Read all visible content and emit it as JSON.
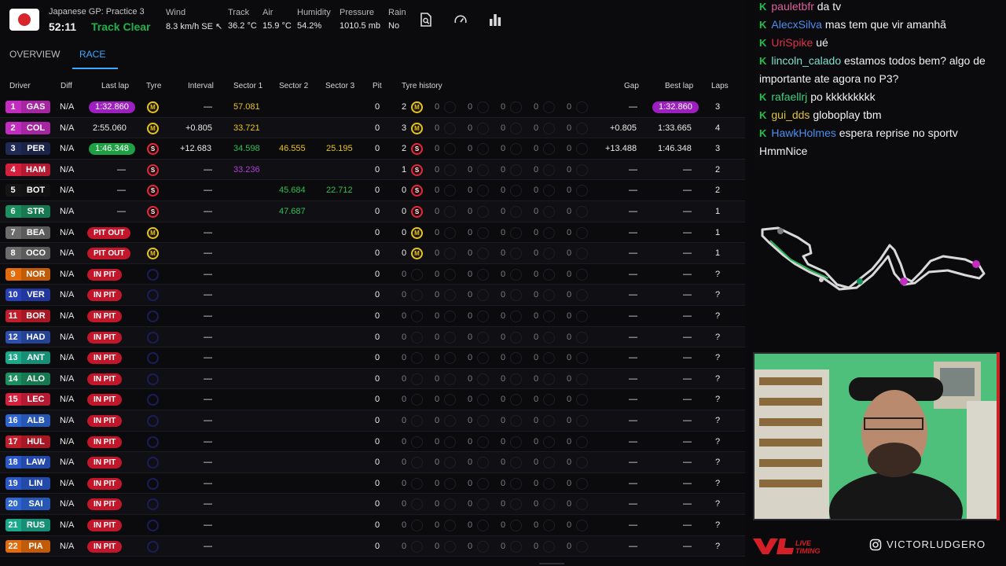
{
  "header": {
    "session_name": "Japanese GP: Practice 3",
    "session_time": "52:11",
    "track_status": "Track Clear",
    "stats": [
      {
        "label": "Wind",
        "value": "8.3 km/h SE ↖"
      },
      {
        "label": "Track",
        "value": "36.2 °C"
      },
      {
        "label": "Air",
        "value": "15.9 °C"
      },
      {
        "label": "Humidity",
        "value": "54.2%"
      },
      {
        "label": "Pressure",
        "value": "1010.5 mb"
      },
      {
        "label": "Rain",
        "value": "No"
      }
    ],
    "icons": [
      "document-search-icon",
      "gauge-icon",
      "bar-chart-icon"
    ]
  },
  "tabs": [
    {
      "label": "OVERVIEW",
      "active": false
    },
    {
      "label": "RACE",
      "active": true
    }
  ],
  "columns": {
    "driver": "Driver",
    "diff": "Diff",
    "last_lap": "Last lap",
    "tyre": "Tyre",
    "interval": "Interval",
    "sector1": "Sector 1",
    "sector2": "Sector 2",
    "sector3": "Sector 3",
    "pit": "Pit",
    "tyre_history": "Tyre history",
    "gap": "Gap",
    "best_lap": "Best lap",
    "laps": "Laps"
  },
  "rows": [
    {
      "pos": "1",
      "code": "GAS",
      "team_color": "#c22cc0",
      "diff": "N/A",
      "last": "1:32.860",
      "last_style": "purple",
      "tyre": "M",
      "interval": "—",
      "s1": "57.081",
      "s1c": "yellow",
      "s2": "",
      "s2c": "",
      "s3": "",
      "s3c": "",
      "pit": "0",
      "hist": [
        {
          "n": "2",
          "t": "M"
        },
        {
          "n": "0"
        },
        {
          "n": "0"
        },
        {
          "n": "0"
        },
        {
          "n": "0"
        },
        {
          "n": "0"
        }
      ],
      "gap": "—",
      "best": "1:32.860",
      "best_style": "purple",
      "laps": "3"
    },
    {
      "pos": "2",
      "code": "COL",
      "team_color": "#c22cc0",
      "diff": "N/A",
      "last": "2:55.060",
      "last_style": "plain",
      "tyre": "M",
      "interval": "+0.805",
      "s1": "33.721",
      "s1c": "yellow",
      "s2": "",
      "s2c": "",
      "s3": "",
      "s3c": "",
      "pit": "0",
      "hist": [
        {
          "n": "3",
          "t": "M"
        },
        {
          "n": "0"
        },
        {
          "n": "0"
        },
        {
          "n": "0"
        },
        {
          "n": "0"
        },
        {
          "n": "0"
        }
      ],
      "gap": "+0.805",
      "best": "1:33.665",
      "best_style": "plain",
      "laps": "4"
    },
    {
      "pos": "3",
      "code": "PER",
      "team_color": "#1f2a55",
      "diff": "N/A",
      "last": "1:46.348",
      "last_style": "green",
      "tyre": "S",
      "interval": "+12.683",
      "s1": "34.598",
      "s1c": "green",
      "s2": "46.555",
      "s2c": "yellow",
      "s3": "25.195",
      "s3c": "yellow",
      "pit": "0",
      "hist": [
        {
          "n": "2",
          "t": "S"
        },
        {
          "n": "0"
        },
        {
          "n": "0"
        },
        {
          "n": "0"
        },
        {
          "n": "0"
        },
        {
          "n": "0"
        }
      ],
      "gap": "+13.488",
      "best": "1:46.348",
      "best_style": "plain",
      "laps": "3"
    },
    {
      "pos": "4",
      "code": "HAM",
      "team_color": "#d51f3c",
      "diff": "N/A",
      "last": "—",
      "last_style": "plain",
      "tyre": "S",
      "interval": "—",
      "s1": "33.236",
      "s1c": "purple",
      "s2": "",
      "s2c": "",
      "s3": "",
      "s3c": "",
      "pit": "0",
      "hist": [
        {
          "n": "1",
          "t": "S"
        },
        {
          "n": "0"
        },
        {
          "n": "0"
        },
        {
          "n": "0"
        },
        {
          "n": "0"
        },
        {
          "n": "0"
        }
      ],
      "gap": "—",
      "best": "—",
      "best_style": "plain",
      "laps": "2"
    },
    {
      "pos": "5",
      "code": "BOT",
      "team_color": "#151515",
      "diff": "N/A",
      "last": "—",
      "last_style": "plain",
      "tyre": "S",
      "interval": "—",
      "s1": "",
      "s1c": "",
      "s2": "45.684",
      "s2c": "green",
      "s3": "22.712",
      "s3c": "green",
      "pit": "0",
      "hist": [
        {
          "n": "0",
          "t": "S"
        },
        {
          "n": "0"
        },
        {
          "n": "0"
        },
        {
          "n": "0"
        },
        {
          "n": "0"
        },
        {
          "n": "0"
        }
      ],
      "gap": "—",
      "best": "—",
      "best_style": "plain",
      "laps": "2"
    },
    {
      "pos": "6",
      "code": "STR",
      "team_color": "#1c8f5f",
      "diff": "N/A",
      "last": "—",
      "last_style": "plain",
      "tyre": "S",
      "interval": "—",
      "s1": "",
      "s1c": "",
      "s2": "47.687",
      "s2c": "green",
      "s3": "",
      "s3c": "",
      "pit": "0",
      "hist": [
        {
          "n": "0",
          "t": "S"
        },
        {
          "n": "0"
        },
        {
          "n": "0"
        },
        {
          "n": "0"
        },
        {
          "n": "0"
        },
        {
          "n": "0"
        }
      ],
      "gap": "—",
      "best": "—",
      "best_style": "plain",
      "laps": "1"
    },
    {
      "pos": "7",
      "code": "BEA",
      "team_color": "#6c6c6c",
      "diff": "N/A",
      "last": "PIT OUT",
      "last_style": "red",
      "tyre": "M",
      "interval": "—",
      "s1": "",
      "s1c": "",
      "s2": "",
      "s2c": "",
      "s3": "",
      "s3c": "",
      "pit": "0",
      "hist": [
        {
          "n": "0",
          "t": "M"
        },
        {
          "n": "0"
        },
        {
          "n": "0"
        },
        {
          "n": "0"
        },
        {
          "n": "0"
        },
        {
          "n": "0"
        }
      ],
      "gap": "—",
      "best": "—",
      "best_style": "plain",
      "laps": "1"
    },
    {
      "pos": "8",
      "code": "OCO",
      "team_color": "#6c6c6c",
      "diff": "N/A",
      "last": "PIT OUT",
      "last_style": "red",
      "tyre": "M",
      "interval": "—",
      "s1": "",
      "s1c": "",
      "s2": "",
      "s2c": "",
      "s3": "",
      "s3c": "",
      "pit": "0",
      "hist": [
        {
          "n": "0",
          "t": "M"
        },
        {
          "n": "0"
        },
        {
          "n": "0"
        },
        {
          "n": "0"
        },
        {
          "n": "0"
        },
        {
          "n": "0"
        }
      ],
      "gap": "—",
      "best": "—",
      "best_style": "plain",
      "laps": "1"
    },
    {
      "pos": "9",
      "code": "NOR",
      "team_color": "#e36b0a",
      "diff": "N/A",
      "last": "IN PIT",
      "last_style": "red",
      "tyre": "none",
      "interval": "—",
      "s1": "",
      "s1c": "",
      "s2": "",
      "s2c": "",
      "s3": "",
      "s3c": "",
      "pit": "0",
      "hist": [
        {
          "n": "0"
        },
        {
          "n": "0"
        },
        {
          "n": "0"
        },
        {
          "n": "0"
        },
        {
          "n": "0"
        },
        {
          "n": "0"
        }
      ],
      "gap": "—",
      "best": "—",
      "best_style": "plain",
      "laps": "?"
    },
    {
      "pos": "10",
      "code": "VER",
      "team_color": "#2741b8",
      "diff": "N/A",
      "last": "IN PIT",
      "last_style": "red",
      "tyre": "none",
      "interval": "—",
      "s1": "",
      "s1c": "",
      "s2": "",
      "s2c": "",
      "s3": "",
      "s3c": "",
      "pit": "0",
      "hist": [
        {
          "n": "0"
        },
        {
          "n": "0"
        },
        {
          "n": "0"
        },
        {
          "n": "0"
        },
        {
          "n": "0"
        },
        {
          "n": "0"
        }
      ],
      "gap": "—",
      "best": "—",
      "best_style": "plain",
      "laps": "?"
    },
    {
      "pos": "11",
      "code": "BOR",
      "team_color": "#c21d2b",
      "diff": "N/A",
      "last": "IN PIT",
      "last_style": "red",
      "tyre": "none",
      "interval": "—",
      "s1": "",
      "s1c": "",
      "s2": "",
      "s2c": "",
      "s3": "",
      "s3c": "",
      "pit": "0",
      "hist": [
        {
          "n": "0"
        },
        {
          "n": "0"
        },
        {
          "n": "0"
        },
        {
          "n": "0"
        },
        {
          "n": "0"
        },
        {
          "n": "0"
        }
      ],
      "gap": "—",
      "best": "—",
      "best_style": "plain",
      "laps": "?"
    },
    {
      "pos": "12",
      "code": "HAD",
      "team_color": "#2c4fb0",
      "diff": "N/A",
      "last": "IN PIT",
      "last_style": "red",
      "tyre": "none",
      "interval": "—",
      "s1": "",
      "s1c": "",
      "s2": "",
      "s2c": "",
      "s3": "",
      "s3c": "",
      "pit": "0",
      "hist": [
        {
          "n": "0"
        },
        {
          "n": "0"
        },
        {
          "n": "0"
        },
        {
          "n": "0"
        },
        {
          "n": "0"
        },
        {
          "n": "0"
        }
      ],
      "gap": "—",
      "best": "—",
      "best_style": "plain",
      "laps": "?"
    },
    {
      "pos": "13",
      "code": "ANT",
      "team_color": "#19a98b",
      "diff": "N/A",
      "last": "IN PIT",
      "last_style": "red",
      "tyre": "none",
      "interval": "—",
      "s1": "",
      "s1c": "",
      "s2": "",
      "s2c": "",
      "s3": "",
      "s3c": "",
      "pit": "0",
      "hist": [
        {
          "n": "0"
        },
        {
          "n": "0"
        },
        {
          "n": "0"
        },
        {
          "n": "0"
        },
        {
          "n": "0"
        },
        {
          "n": "0"
        }
      ],
      "gap": "—",
      "best": "—",
      "best_style": "plain",
      "laps": "?"
    },
    {
      "pos": "14",
      "code": "ALO",
      "team_color": "#1c8f5f",
      "diff": "N/A",
      "last": "IN PIT",
      "last_style": "red",
      "tyre": "none",
      "interval": "—",
      "s1": "",
      "s1c": "",
      "s2": "",
      "s2c": "",
      "s3": "",
      "s3c": "",
      "pit": "0",
      "hist": [
        {
          "n": "0"
        },
        {
          "n": "0"
        },
        {
          "n": "0"
        },
        {
          "n": "0"
        },
        {
          "n": "0"
        },
        {
          "n": "0"
        }
      ],
      "gap": "—",
      "best": "—",
      "best_style": "plain",
      "laps": "?"
    },
    {
      "pos": "15",
      "code": "LEC",
      "team_color": "#d51f3c",
      "diff": "N/A",
      "last": "IN PIT",
      "last_style": "red",
      "tyre": "none",
      "interval": "—",
      "s1": "",
      "s1c": "",
      "s2": "",
      "s2c": "",
      "s3": "",
      "s3c": "",
      "pit": "0",
      "hist": [
        {
          "n": "0"
        },
        {
          "n": "0"
        },
        {
          "n": "0"
        },
        {
          "n": "0"
        },
        {
          "n": "0"
        },
        {
          "n": "0"
        }
      ],
      "gap": "—",
      "best": "—",
      "best_style": "plain",
      "laps": "?"
    },
    {
      "pos": "16",
      "code": "ALB",
      "team_color": "#2e67d4",
      "diff": "N/A",
      "last": "IN PIT",
      "last_style": "red",
      "tyre": "none",
      "interval": "—",
      "s1": "",
      "s1c": "",
      "s2": "",
      "s2c": "",
      "s3": "",
      "s3c": "",
      "pit": "0",
      "hist": [
        {
          "n": "0"
        },
        {
          "n": "0"
        },
        {
          "n": "0"
        },
        {
          "n": "0"
        },
        {
          "n": "0"
        },
        {
          "n": "0"
        }
      ],
      "gap": "—",
      "best": "—",
      "best_style": "plain",
      "laps": "?"
    },
    {
      "pos": "17",
      "code": "HUL",
      "team_color": "#c21d2b",
      "diff": "N/A",
      "last": "IN PIT",
      "last_style": "red",
      "tyre": "none",
      "interval": "—",
      "s1": "",
      "s1c": "",
      "s2": "",
      "s2c": "",
      "s3": "",
      "s3c": "",
      "pit": "0",
      "hist": [
        {
          "n": "0"
        },
        {
          "n": "0"
        },
        {
          "n": "0"
        },
        {
          "n": "0"
        },
        {
          "n": "0"
        },
        {
          "n": "0"
        }
      ],
      "gap": "—",
      "best": "—",
      "best_style": "plain",
      "laps": "?"
    },
    {
      "pos": "18",
      "code": "LAW",
      "team_color": "#2a57c9",
      "diff": "N/A",
      "last": "IN PIT",
      "last_style": "red",
      "tyre": "none",
      "interval": "—",
      "s1": "",
      "s1c": "",
      "s2": "",
      "s2c": "",
      "s3": "",
      "s3c": "",
      "pit": "0",
      "hist": [
        {
          "n": "0"
        },
        {
          "n": "0"
        },
        {
          "n": "0"
        },
        {
          "n": "0"
        },
        {
          "n": "0"
        },
        {
          "n": "0"
        }
      ],
      "gap": "—",
      "best": "—",
      "best_style": "plain",
      "laps": "?"
    },
    {
      "pos": "19",
      "code": "LIN",
      "team_color": "#2a57c9",
      "diff": "N/A",
      "last": "IN PIT",
      "last_style": "red",
      "tyre": "none",
      "interval": "—",
      "s1": "",
      "s1c": "",
      "s2": "",
      "s2c": "",
      "s3": "",
      "s3c": "",
      "pit": "0",
      "hist": [
        {
          "n": "0"
        },
        {
          "n": "0"
        },
        {
          "n": "0"
        },
        {
          "n": "0"
        },
        {
          "n": "0"
        },
        {
          "n": "0"
        }
      ],
      "gap": "—",
      "best": "—",
      "best_style": "plain",
      "laps": "?"
    },
    {
      "pos": "20",
      "code": "SAI",
      "team_color": "#2e67d4",
      "diff": "N/A",
      "last": "IN PIT",
      "last_style": "red",
      "tyre": "none",
      "interval": "—",
      "s1": "",
      "s1c": "",
      "s2": "",
      "s2c": "",
      "s3": "",
      "s3c": "",
      "pit": "0",
      "hist": [
        {
          "n": "0"
        },
        {
          "n": "0"
        },
        {
          "n": "0"
        },
        {
          "n": "0"
        },
        {
          "n": "0"
        },
        {
          "n": "0"
        }
      ],
      "gap": "—",
      "best": "—",
      "best_style": "plain",
      "laps": "?"
    },
    {
      "pos": "21",
      "code": "RUS",
      "team_color": "#19a98b",
      "diff": "N/A",
      "last": "IN PIT",
      "last_style": "red",
      "tyre": "none",
      "interval": "—",
      "s1": "",
      "s1c": "",
      "s2": "",
      "s2c": "",
      "s3": "",
      "s3c": "",
      "pit": "0",
      "hist": [
        {
          "n": "0"
        },
        {
          "n": "0"
        },
        {
          "n": "0"
        },
        {
          "n": "0"
        },
        {
          "n": "0"
        },
        {
          "n": "0"
        }
      ],
      "gap": "—",
      "best": "—",
      "best_style": "plain",
      "laps": "?"
    },
    {
      "pos": "22",
      "code": "PIA",
      "team_color": "#e36b0a",
      "diff": "N/A",
      "last": "IN PIT",
      "last_style": "red",
      "tyre": "none",
      "interval": "—",
      "s1": "",
      "s1c": "",
      "s2": "",
      "s2c": "",
      "s3": "",
      "s3c": "",
      "pit": "0",
      "hist": [
        {
          "n": "0"
        },
        {
          "n": "0"
        },
        {
          "n": "0"
        },
        {
          "n": "0"
        },
        {
          "n": "0"
        },
        {
          "n": "0"
        }
      ],
      "gap": "—",
      "best": "—",
      "best_style": "plain",
      "laps": "?"
    }
  ],
  "chat": [
    {
      "user": "pauletbfr",
      "color": "#e0609b",
      "text": "da tv"
    },
    {
      "user": "AlecxSilva",
      "color": "#4b8ef0",
      "text": "mas tem que vir amanhã"
    },
    {
      "user": "UriSpike",
      "color": "#e0304a",
      "text": "ué"
    },
    {
      "user": "lincoln_calado",
      "color": "#7fe0d0",
      "text": "estamos todos bem? algo de importante ate agora no P3?"
    },
    {
      "user": "rafaellrj",
      "color": "#40d080",
      "text": "po kkkkkkkkk"
    },
    {
      "user": "gui_dds",
      "color": "#e0c040",
      "text": "globoplay tbm"
    },
    {
      "user": "HawkHolmes",
      "color": "#4b8ef0",
      "text": "espera reprise no sportv HmmNice"
    }
  ],
  "footer": {
    "logo_text": "VL LIVE TIMING",
    "handle": "VICTORLUDGERO"
  }
}
